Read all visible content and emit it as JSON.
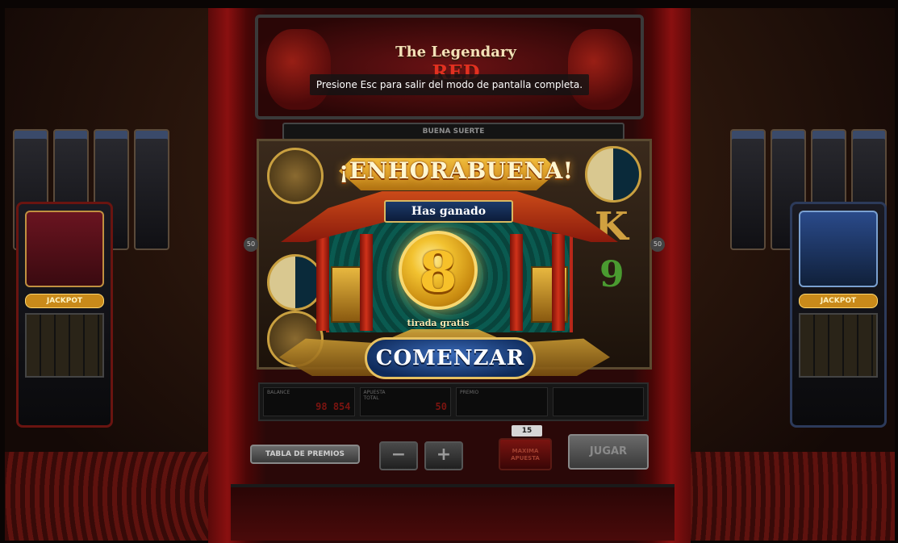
{
  "topper": {
    "logo_line1": "The",
    "logo_line2": "Legendary",
    "logo_red": "RED"
  },
  "fullscreen_notice": "Presione Esc para salir del modo de pantalla completa.",
  "status_bar": "BUENA SUERTE",
  "reels": {
    "line_marker_left": "50",
    "line_marker_right": "50",
    "letter_k": "K",
    "number_9": "9"
  },
  "popup": {
    "title": "¡ENHORABUENA!",
    "subtitle": "Has ganado",
    "free_spins_count": "8",
    "free_spins_label": "tirada gratis",
    "start_button": "COMENZAR"
  },
  "meters": {
    "balance_label": "BALANCE",
    "balance_value": "98 854",
    "bet_label": "APUESTA TOTAL",
    "bet_value": "50",
    "win_label": "PREMIO",
    "win_value": ""
  },
  "controls": {
    "paytable": "TABLA DE PREMIOS",
    "minus": "−",
    "plus": "+",
    "bet_lines": "15",
    "max_bet": "MAXIMA APUESTA",
    "play": "JUGAR"
  },
  "side_cabinets": {
    "left_jackpot": "JACKPOT",
    "right_jackpot": "JACKPOT"
  },
  "colors": {
    "cabinet_red": "#8a1010",
    "gold": "#f2c230",
    "button_blue": "#0e2a5a",
    "teal_panel": "#0a5a50"
  }
}
